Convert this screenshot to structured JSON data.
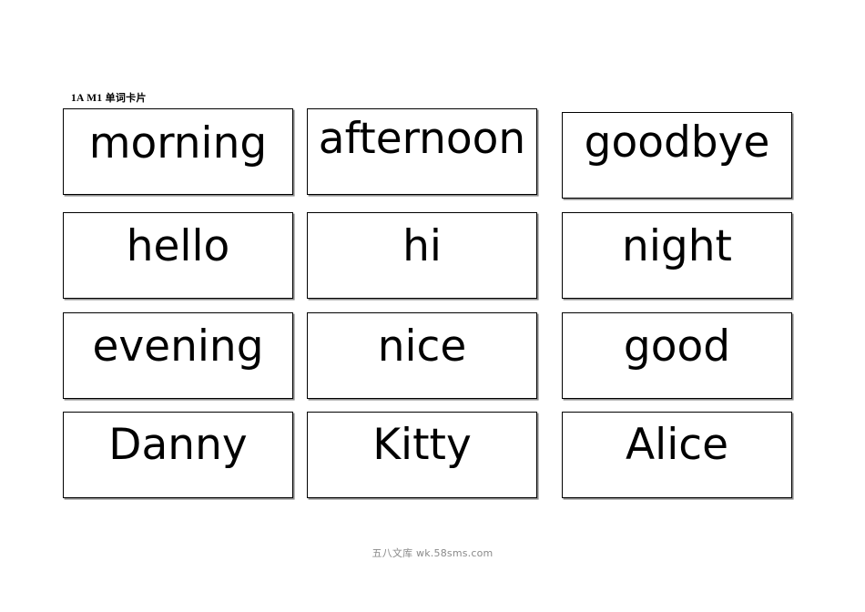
{
  "document": {
    "header_label": "1A  M1 单词卡片",
    "header_code": "1A  M1 ",
    "header_cn": "单词卡片",
    "watermark": "五八文库 wk.58sms.com",
    "ink_color": "#000000",
    "card_border_color": "#000000",
    "card_shadow_color": "#8c8c8c",
    "watermark_color": "#8a8a8a",
    "page_background": "#ffffff"
  },
  "cards": {
    "rows": [
      {
        "row_index": 1,
        "items": [
          {
            "word": "morning"
          },
          {
            "word": "afternoon"
          },
          {
            "word": "goodbye"
          }
        ]
      },
      {
        "row_index": 2,
        "items": [
          {
            "word": "hello"
          },
          {
            "word": "hi"
          },
          {
            "word": "night"
          }
        ]
      },
      {
        "row_index": 3,
        "items": [
          {
            "word": "evening"
          },
          {
            "word": "nice"
          },
          {
            "word": "good"
          }
        ]
      },
      {
        "row_index": 4,
        "items": [
          {
            "word": "Danny"
          },
          {
            "word": "Kitty"
          },
          {
            "word": "Alice"
          }
        ]
      }
    ]
  }
}
